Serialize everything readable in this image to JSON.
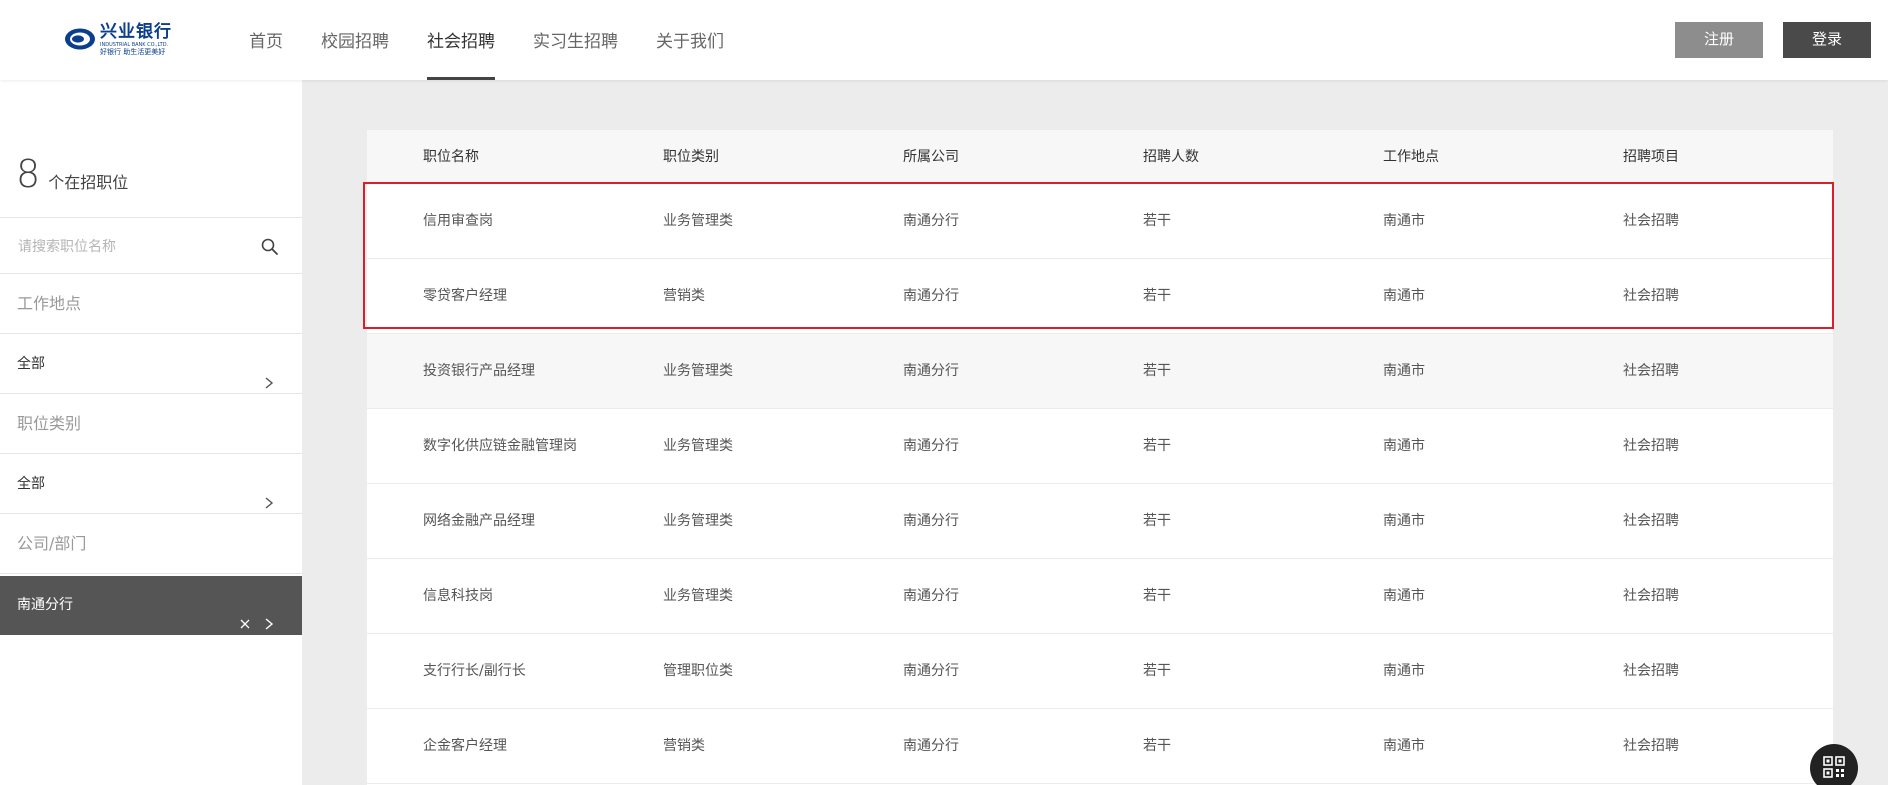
{
  "brand": {
    "name_cn": "兴业银行",
    "name_en": "INDUSTRIAL BANK CO.,LTD.",
    "slogan": "好银行 助生活更美好",
    "color": "#0b3f8e"
  },
  "nav": {
    "items": [
      {
        "label": "首页",
        "active": false
      },
      {
        "label": "校园招聘",
        "active": false
      },
      {
        "label": "社会招聘",
        "active": true
      },
      {
        "label": "实习生招聘",
        "active": false
      },
      {
        "label": "关于我们",
        "active": false
      }
    ],
    "register_label": "注册",
    "login_label": "登录"
  },
  "sidebar": {
    "count": "8",
    "count_label": "个在招职位",
    "search_placeholder": "请搜索职位名称",
    "search_value": "",
    "location_title": "工作地点",
    "location_value": "全部",
    "category_title": "职位类别",
    "category_value": "全部",
    "company_title": "公司/部门",
    "company_value": "南通分行"
  },
  "table": {
    "headers": [
      "职位名称",
      "职位类别",
      "所属公司",
      "招聘人数",
      "工作地点",
      "招聘项目"
    ],
    "rows": [
      [
        "信用审查岗",
        "业务管理类",
        "南通分行",
        "若干",
        "南通市",
        "社会招聘"
      ],
      [
        "零贷客户经理",
        "营销类",
        "南通分行",
        "若干",
        "南通市",
        "社会招聘"
      ],
      [
        "投资银行产品经理",
        "业务管理类",
        "南通分行",
        "若干",
        "南通市",
        "社会招聘"
      ],
      [
        "数字化供应链金融管理岗",
        "业务管理类",
        "南通分行",
        "若干",
        "南通市",
        "社会招聘"
      ],
      [
        "网络金融产品经理",
        "业务管理类",
        "南通分行",
        "若干",
        "南通市",
        "社会招聘"
      ],
      [
        "信息科技岗",
        "业务管理类",
        "南通分行",
        "若干",
        "南通市",
        "社会招聘"
      ],
      [
        "支行行长/副行长",
        "管理职位类",
        "南通分行",
        "若干",
        "南通市",
        "社会招聘"
      ],
      [
        "企金客户经理",
        "营销类",
        "南通分行",
        "若干",
        "南通市",
        "社会招聘"
      ]
    ],
    "hover_row": 2,
    "highlight_color": "#d6202a"
  },
  "icons": {
    "search": "search-icon",
    "chevron": "chevron-right-icon",
    "clear": "close-icon",
    "qr": "qr-code-icon"
  }
}
